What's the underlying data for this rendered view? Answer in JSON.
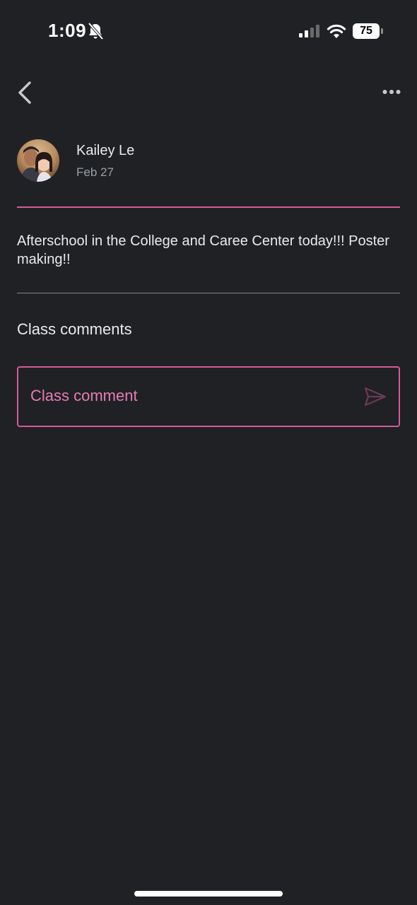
{
  "status_bar": {
    "time": "1:09",
    "battery_level": "75",
    "cellular_bars_filled": 2,
    "cellular_bars_total": 4,
    "icons": [
      "bell-slash-icon",
      "signal-icon",
      "wifi-icon",
      "battery-icon"
    ]
  },
  "top_bar": {
    "back_icon": "chevron-left-icon",
    "more_icon": "more-horizontal-icon"
  },
  "post": {
    "author": "Kailey Le",
    "date": "Feb 27",
    "body": "Afterschool in the College and Caree Center today!!! Poster making!!"
  },
  "comments": {
    "heading": "Class comments",
    "input_placeholder": "Class comment",
    "send_icon": "send-icon"
  },
  "colors": {
    "background": "#202124",
    "accent": "#d55a9b",
    "placeholder": "#e77cb6",
    "text_primary": "#e8eaed",
    "text_secondary": "#9aa0a6"
  }
}
